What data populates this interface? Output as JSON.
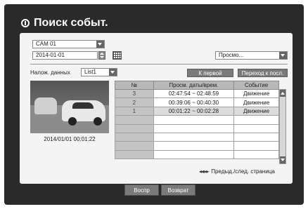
{
  "dialog": {
    "title": "Поиск событ."
  },
  "filters": {
    "camera": "CAM 01",
    "date": "2014-01-01",
    "mode": "Просмо..."
  },
  "overlap": {
    "label": "Налож. данных",
    "value": "List1"
  },
  "buttons": {
    "first": "К первой",
    "goto_last": "Переход к посл.",
    "play": "Воспр",
    "back": "Возврат"
  },
  "preview": {
    "timestamp": "2014/01/01  00:01:22"
  },
  "table": {
    "headers": [
      "№",
      "Просм. даты/врем.",
      "Событие"
    ],
    "rows": [
      {
        "num": "3",
        "time": "02:47:54 ~ 02:48:59",
        "event": "Движение"
      },
      {
        "num": "2",
        "time": "00:39:06 ~ 00:40:30",
        "event": "Движение"
      },
      {
        "num": "1",
        "time": "00:01:22 ~ 00:02:28",
        "event": "Движение"
      }
    ]
  },
  "pager": {
    "arrows": "◂◂ ▸▸",
    "label": "Предыд./след. страница"
  },
  "colors": {
    "frame": "#2a2a2a",
    "panel": "#f4f4f4",
    "button": "#7a7a7a",
    "header": "#b8b8b8"
  }
}
